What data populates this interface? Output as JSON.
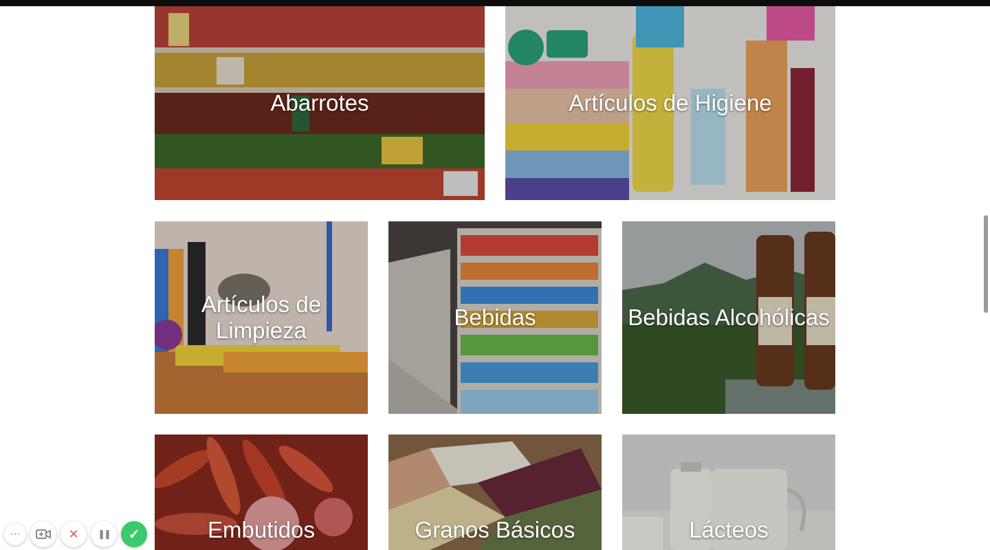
{
  "categories": [
    {
      "label": "Abarrotes"
    },
    {
      "label": "Artículos de Higiene"
    },
    {
      "label": "Artículos de\nLimpieza"
    },
    {
      "label": "Bebidas"
    },
    {
      "label": "Bebidas Alcohólicas"
    },
    {
      "label": "Embutidos"
    },
    {
      "label": "Granos Básicos"
    },
    {
      "label": "Lácteos"
    }
  ],
  "recorder": {
    "more": "···",
    "close": "✕",
    "pause": "❚❚",
    "done": "✓"
  }
}
